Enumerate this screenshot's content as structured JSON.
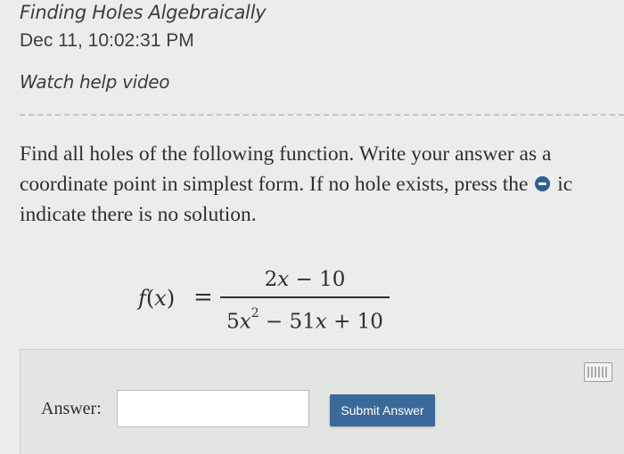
{
  "header": {
    "title": "Finding Holes Algebraically",
    "timestamp": "Dec 11, 10:02:31 PM",
    "help_link": "Watch help video"
  },
  "question": {
    "line1": "Find all holes of the following function. Write your answer as a",
    "line2_before": "coordinate point in simplest form. If no hole exists, press the",
    "line2_after": "ic",
    "line3": "indicate there is no solution.",
    "icon": "minus-circle-icon"
  },
  "formula": {
    "fn": "f",
    "arg": "x",
    "equals": "=",
    "numerator": {
      "coef": "2",
      "var": "x",
      "rest": " − 10"
    },
    "denominator": {
      "coef1": "5",
      "var1": "x",
      "exp": "2",
      "mid": " − 51",
      "var2": "x",
      "rest": " + 10"
    }
  },
  "answer": {
    "label": "Answer:",
    "input_value": "",
    "submit_label": "Submit Answer",
    "keyboard_icon": "keyboard-icon"
  },
  "colors": {
    "button": "#3a6a9a",
    "icon": "#2f5f8f",
    "background": "#ecedeb"
  }
}
